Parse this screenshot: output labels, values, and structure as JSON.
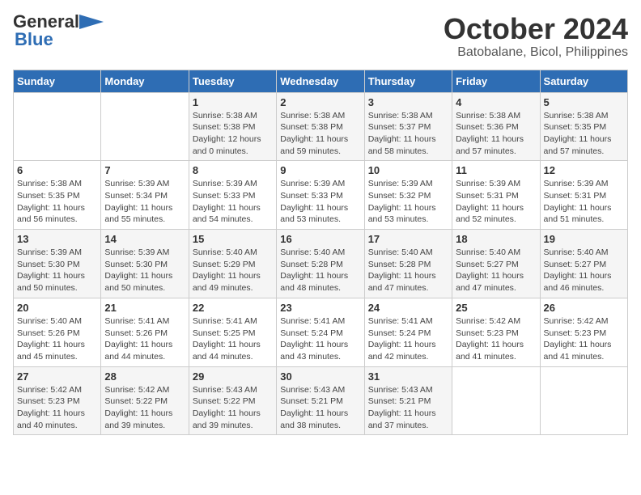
{
  "header": {
    "logo_general": "General",
    "logo_blue": "Blue",
    "title": "October 2024",
    "subtitle": "Batobalane, Bicol, Philippines"
  },
  "days_of_week": [
    "Sunday",
    "Monday",
    "Tuesday",
    "Wednesday",
    "Thursday",
    "Friday",
    "Saturday"
  ],
  "weeks": [
    [
      {
        "date": "",
        "info": ""
      },
      {
        "date": "",
        "info": ""
      },
      {
        "date": "1",
        "info": "Sunrise: 5:38 AM\nSunset: 5:38 PM\nDaylight: 12 hours\nand 0 minutes."
      },
      {
        "date": "2",
        "info": "Sunrise: 5:38 AM\nSunset: 5:38 PM\nDaylight: 11 hours\nand 59 minutes."
      },
      {
        "date": "3",
        "info": "Sunrise: 5:38 AM\nSunset: 5:37 PM\nDaylight: 11 hours\nand 58 minutes."
      },
      {
        "date": "4",
        "info": "Sunrise: 5:38 AM\nSunset: 5:36 PM\nDaylight: 11 hours\nand 57 minutes."
      },
      {
        "date": "5",
        "info": "Sunrise: 5:38 AM\nSunset: 5:35 PM\nDaylight: 11 hours\nand 57 minutes."
      }
    ],
    [
      {
        "date": "6",
        "info": "Sunrise: 5:38 AM\nSunset: 5:35 PM\nDaylight: 11 hours\nand 56 minutes."
      },
      {
        "date": "7",
        "info": "Sunrise: 5:39 AM\nSunset: 5:34 PM\nDaylight: 11 hours\nand 55 minutes."
      },
      {
        "date": "8",
        "info": "Sunrise: 5:39 AM\nSunset: 5:33 PM\nDaylight: 11 hours\nand 54 minutes."
      },
      {
        "date": "9",
        "info": "Sunrise: 5:39 AM\nSunset: 5:33 PM\nDaylight: 11 hours\nand 53 minutes."
      },
      {
        "date": "10",
        "info": "Sunrise: 5:39 AM\nSunset: 5:32 PM\nDaylight: 11 hours\nand 53 minutes."
      },
      {
        "date": "11",
        "info": "Sunrise: 5:39 AM\nSunset: 5:31 PM\nDaylight: 11 hours\nand 52 minutes."
      },
      {
        "date": "12",
        "info": "Sunrise: 5:39 AM\nSunset: 5:31 PM\nDaylight: 11 hours\nand 51 minutes."
      }
    ],
    [
      {
        "date": "13",
        "info": "Sunrise: 5:39 AM\nSunset: 5:30 PM\nDaylight: 11 hours\nand 50 minutes."
      },
      {
        "date": "14",
        "info": "Sunrise: 5:39 AM\nSunset: 5:30 PM\nDaylight: 11 hours\nand 50 minutes."
      },
      {
        "date": "15",
        "info": "Sunrise: 5:40 AM\nSunset: 5:29 PM\nDaylight: 11 hours\nand 49 minutes."
      },
      {
        "date": "16",
        "info": "Sunrise: 5:40 AM\nSunset: 5:28 PM\nDaylight: 11 hours\nand 48 minutes."
      },
      {
        "date": "17",
        "info": "Sunrise: 5:40 AM\nSunset: 5:28 PM\nDaylight: 11 hours\nand 47 minutes."
      },
      {
        "date": "18",
        "info": "Sunrise: 5:40 AM\nSunset: 5:27 PM\nDaylight: 11 hours\nand 47 minutes."
      },
      {
        "date": "19",
        "info": "Sunrise: 5:40 AM\nSunset: 5:27 PM\nDaylight: 11 hours\nand 46 minutes."
      }
    ],
    [
      {
        "date": "20",
        "info": "Sunrise: 5:40 AM\nSunset: 5:26 PM\nDaylight: 11 hours\nand 45 minutes."
      },
      {
        "date": "21",
        "info": "Sunrise: 5:41 AM\nSunset: 5:26 PM\nDaylight: 11 hours\nand 44 minutes."
      },
      {
        "date": "22",
        "info": "Sunrise: 5:41 AM\nSunset: 5:25 PM\nDaylight: 11 hours\nand 44 minutes."
      },
      {
        "date": "23",
        "info": "Sunrise: 5:41 AM\nSunset: 5:24 PM\nDaylight: 11 hours\nand 43 minutes."
      },
      {
        "date": "24",
        "info": "Sunrise: 5:41 AM\nSunset: 5:24 PM\nDaylight: 11 hours\nand 42 minutes."
      },
      {
        "date": "25",
        "info": "Sunrise: 5:42 AM\nSunset: 5:23 PM\nDaylight: 11 hours\nand 41 minutes."
      },
      {
        "date": "26",
        "info": "Sunrise: 5:42 AM\nSunset: 5:23 PM\nDaylight: 11 hours\nand 41 minutes."
      }
    ],
    [
      {
        "date": "27",
        "info": "Sunrise: 5:42 AM\nSunset: 5:23 PM\nDaylight: 11 hours\nand 40 minutes."
      },
      {
        "date": "28",
        "info": "Sunrise: 5:42 AM\nSunset: 5:22 PM\nDaylight: 11 hours\nand 39 minutes."
      },
      {
        "date": "29",
        "info": "Sunrise: 5:43 AM\nSunset: 5:22 PM\nDaylight: 11 hours\nand 39 minutes."
      },
      {
        "date": "30",
        "info": "Sunrise: 5:43 AM\nSunset: 5:21 PM\nDaylight: 11 hours\nand 38 minutes."
      },
      {
        "date": "31",
        "info": "Sunrise: 5:43 AM\nSunset: 5:21 PM\nDaylight: 11 hours\nand 37 minutes."
      },
      {
        "date": "",
        "info": ""
      },
      {
        "date": "",
        "info": ""
      }
    ]
  ]
}
